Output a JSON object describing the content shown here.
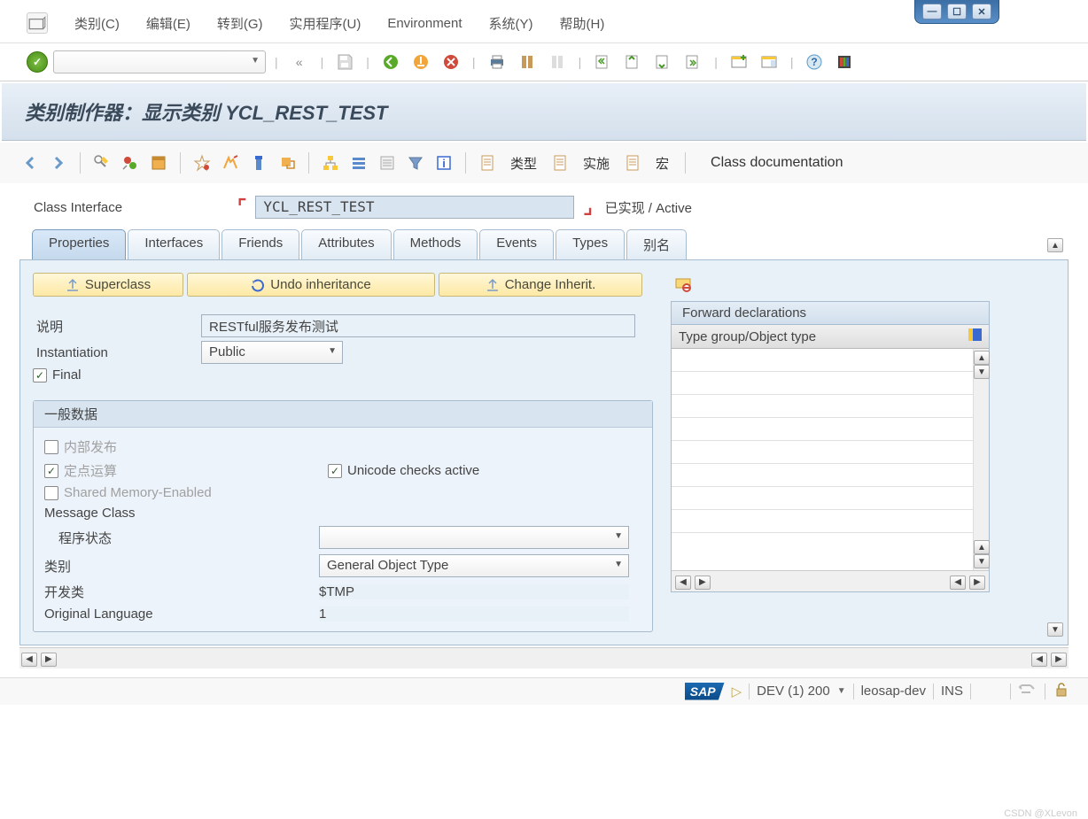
{
  "menu": {
    "items": [
      "类别(C)",
      "编辑(E)",
      "转到(G)",
      "实用程序(U)",
      "Environment",
      "系统(Y)",
      "帮助(H)"
    ]
  },
  "title": "类别制作器：显示类别 YCL_REST_TEST",
  "action_labels": {
    "type": "类型",
    "impl": "实施",
    "macro": "宏",
    "doc": "Class documentation"
  },
  "class_interface": {
    "label": "Class Interface",
    "value": "YCL_REST_TEST",
    "status": "已实现 / Active"
  },
  "tabs": [
    "Properties",
    "Interfaces",
    "Friends",
    "Attributes",
    "Methods",
    "Events",
    "Types",
    "别名"
  ],
  "inheritance": {
    "superclass": "Superclass",
    "undo": "Undo inheritance",
    "change": "Change Inherit."
  },
  "properties": {
    "desc_label": "说明",
    "desc_value": "RESTful服务发布测试",
    "instantiation_label": "Instantiation",
    "instantiation_value": "Public",
    "final_label": "Final"
  },
  "general": {
    "title": "一般数据",
    "internal": "内部发布",
    "fixed_point": "定点运算",
    "unicode": "Unicode checks active",
    "shared_mem": "Shared Memory-Enabled",
    "msg_class_label": "Message Class",
    "msg_class_value": "",
    "prog_status_label": "程序状态",
    "prog_status_value": "",
    "category_label": "类别",
    "category_value": "General Object Type",
    "package_label": "开发类",
    "package_value": "$TMP",
    "orig_lang_label": "Original Language",
    "orig_lang_value": "1"
  },
  "forward_decl": {
    "title": "Forward declarations",
    "col_header": "Type group/Object type"
  },
  "status_bar": {
    "system": "DEV (1) 200",
    "host": "leosap-dev",
    "mode": "INS"
  },
  "watermark": "CSDN @XLevon"
}
